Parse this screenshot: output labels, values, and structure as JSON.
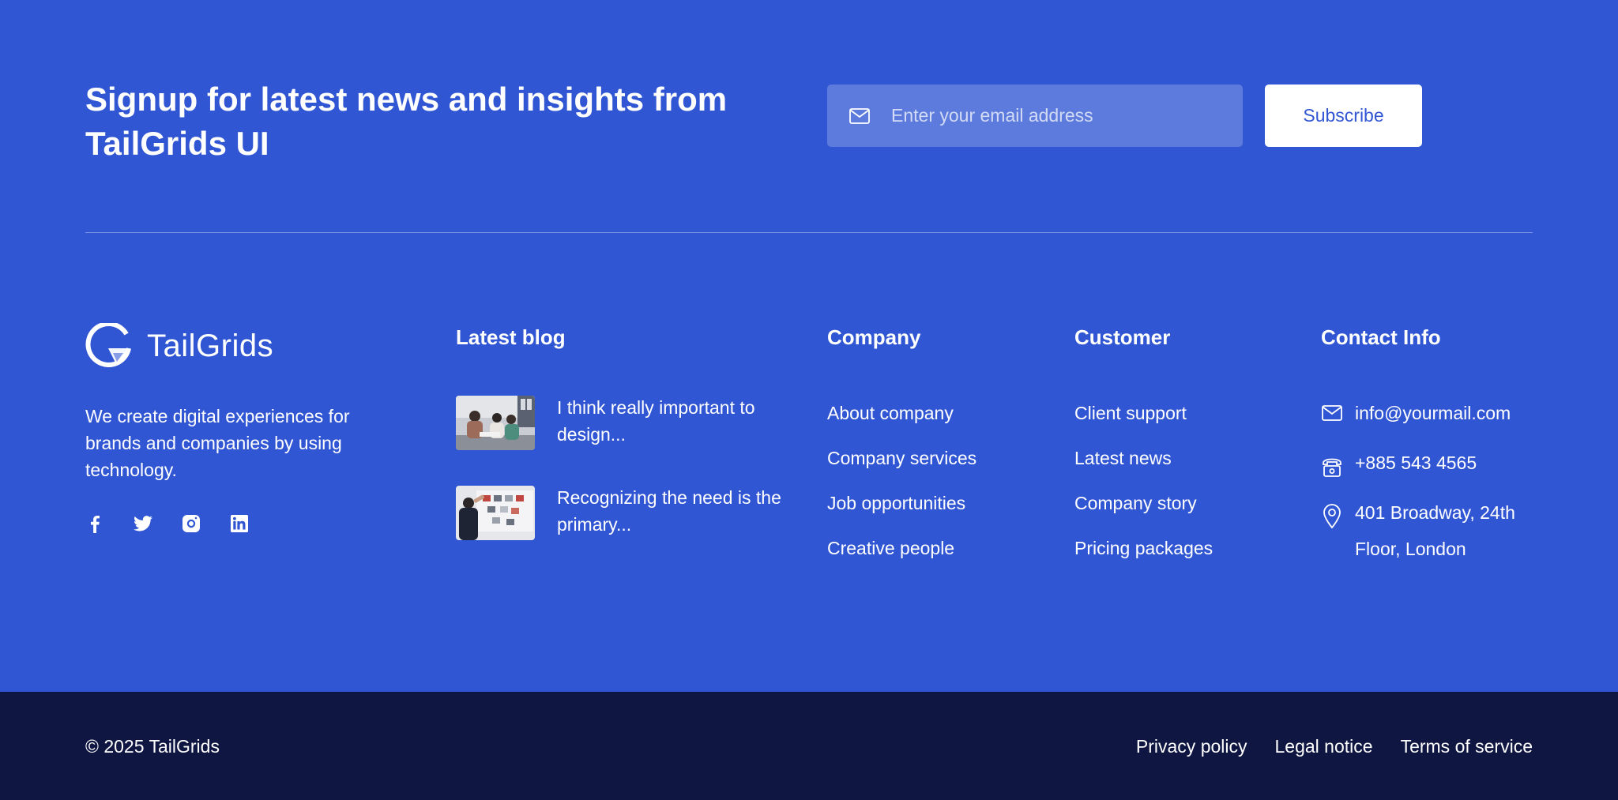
{
  "newsletter": {
    "title": "Signup for latest news and insights from TailGrids UI",
    "email_placeholder": "Enter your email address",
    "subscribe_label": "Subscribe"
  },
  "brand": {
    "name": "TailGrids",
    "description": "We create digital experiences for brands and companies by using technology.",
    "socials": [
      "facebook-icon",
      "twitter-icon",
      "instagram-icon",
      "linkedin-icon"
    ]
  },
  "blog": {
    "title": "Latest blog",
    "posts": [
      {
        "title": "I think really important to design..."
      },
      {
        "title": "Recognizing the need is the primary..."
      }
    ]
  },
  "company": {
    "title": "Company",
    "links": [
      "About company",
      "Company services",
      "Job opportunities",
      "Creative people"
    ]
  },
  "customer": {
    "title": "Customer",
    "links": [
      "Client support",
      "Latest news",
      "Company story",
      "Pricing packages"
    ]
  },
  "contact": {
    "title": "Contact Info",
    "email": "info@yourmail.com",
    "phone": "+885 543 4565",
    "address_line1": "401 Broadway, 24th",
    "address_line2": "Floor, London"
  },
  "bottom": {
    "copyright": "© 2025 TailGrids",
    "links": [
      "Privacy policy",
      "Legal notice",
      "Terms of service"
    ]
  },
  "colors": {
    "primary": "#3056D3",
    "bottom_bar": "#0F1642",
    "text": "#FFFFFF"
  }
}
